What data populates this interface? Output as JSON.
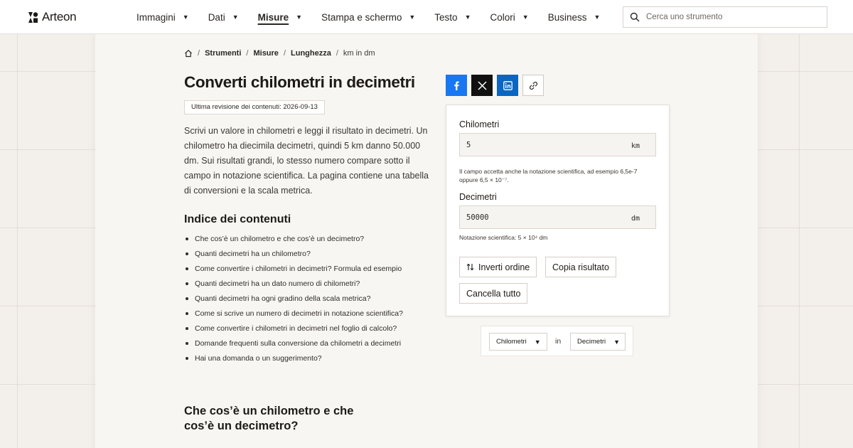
{
  "header": {
    "brand": "Arteon",
    "nav": [
      {
        "label": "Immagini",
        "active": false
      },
      {
        "label": "Dati",
        "active": false
      },
      {
        "label": "Misure",
        "active": true
      },
      {
        "label": "Stampa e schermo",
        "active": false
      },
      {
        "label": "Testo",
        "active": false
      },
      {
        "label": "Colori",
        "active": false
      },
      {
        "label": "Business",
        "active": false
      }
    ],
    "search_placeholder": "Cerca uno strumento"
  },
  "breadcrumb": {
    "items": [
      "Strumenti",
      "Misure",
      "Lunghezza"
    ],
    "current": "km in dm"
  },
  "article": {
    "title": "Converti chilometri in decimetri",
    "revision": "Ultima revisione dei contenuti: 2026-09-13",
    "intro": "Scrivi un valore in chilometri e leggi il risultato in decimetri. Un chilometro ha diecimila decimetri, quindi 5 km danno 50.000 dm. Sui risultati grandi, lo stesso numero compare sotto il campo in notazione scientifica. La pagina contiene una tabella di conversioni e la scala metrica.",
    "toc_title": "Indice dei contenuti",
    "toc": [
      "Che cos’è un chilometro e che cos’è un decimetro?",
      "Quanti decimetri ha un chilometro?",
      "Come convertire i chilometri in decimetri? Formula ed esempio",
      "Quanti decimetri ha un dato numero di chilometri?",
      "Quanti decimetri ha ogni gradino della scala metrica?",
      "Come si scrive un numero di decimetri in notazione scientifica?",
      "Come convertire i chilometri in decimetri nel foglio di calcolo?",
      "Domande frequenti sulla conversione da chilometri a decimetri",
      "Hai una domanda o un suggerimento?"
    ],
    "section_title": "Che cos’è un chilometro e che cos’è un decimetro?"
  },
  "converter": {
    "from_label": "Chilometri",
    "from_value": "5",
    "from_unit": "km",
    "from_hint": "Il campo accetta anche la notazione scientifica, ad esempio 6,5e-7 oppure 6,5 × 10⁻⁷.",
    "to_label": "Decimetri",
    "to_value": "50000",
    "to_unit": "dm",
    "to_hint": "Notazione scientifica: 5 × 10⁴ dm",
    "swap_label": "Inverti ordine",
    "copy_label": "Copia risultato",
    "clear_label": "Cancella tutto"
  },
  "unit_selector": {
    "from": "Chilometri",
    "in_word": "in",
    "to": "Decimetri"
  }
}
